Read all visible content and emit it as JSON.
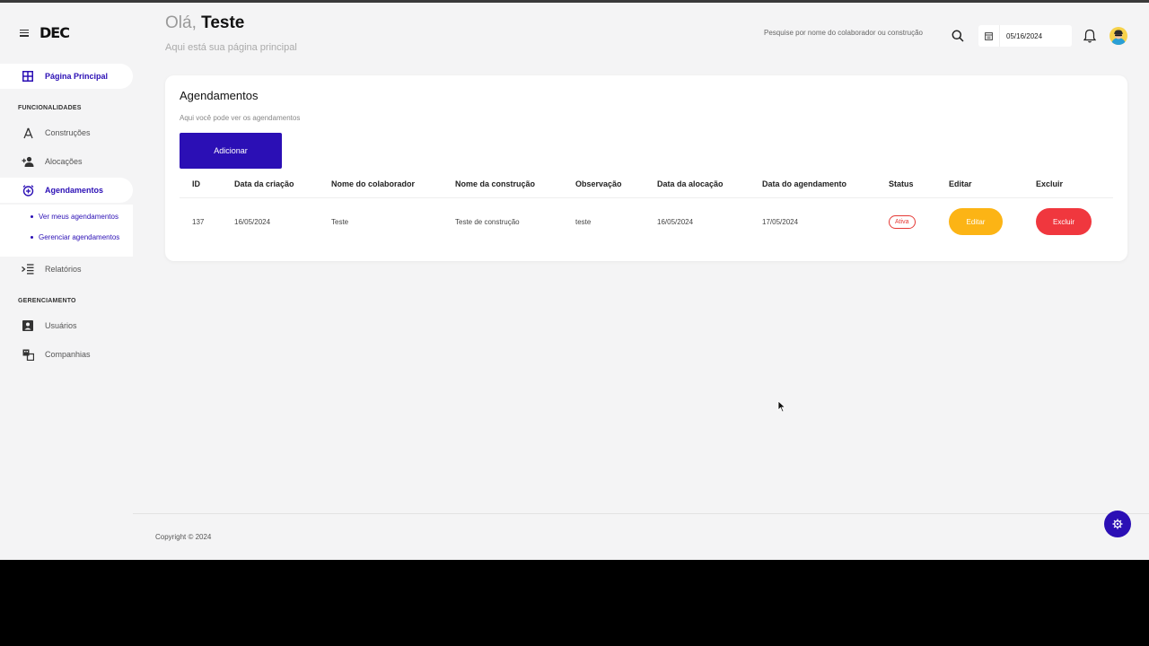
{
  "brand": {
    "logo": "DEC"
  },
  "header": {
    "greeting_prefix": "Olá,",
    "user_name": "Teste",
    "subtitle": "Aqui está sua página principal",
    "search_placeholder": "Pesquise por nome do colaborador ou construção",
    "date_value": "05/16/2024"
  },
  "sidebar": {
    "main_item": "Página Principal",
    "section_features": "FUNCIONALIDADES",
    "items": [
      {
        "label": "Construções",
        "icon": "compass-icon"
      },
      {
        "label": "Alocações",
        "icon": "person-add-icon"
      },
      {
        "label": "Agendamentos",
        "icon": "alarm-clock-icon"
      }
    ],
    "submenu": [
      "Ver meus agendamentos",
      "Gerenciar agendamentos"
    ],
    "reports": "Relatórios",
    "section_management": "GERENCIAMENTO",
    "management_items": [
      {
        "label": "Usuários",
        "icon": "user-card-icon"
      },
      {
        "label": "Companhias",
        "icon": "companies-icon"
      }
    ]
  },
  "card": {
    "title": "Agendamentos",
    "subtitle": "Aqui você pode ver os agendamentos",
    "add_button": "Adicionar",
    "columns": [
      "ID",
      "Data da criação",
      "Nome do colaborador",
      "Nome da construção",
      "Observação",
      "Data da alocação",
      "Data do agendamento",
      "Status",
      "Editar",
      "Excluir"
    ],
    "rows": [
      {
        "id": "137",
        "created": "16/05/2024",
        "collaborator": "Teste",
        "construction": "Teste de construção",
        "note": "teste",
        "allocation_date": "16/05/2024",
        "schedule_date": "17/05/2024",
        "status": "Ativa",
        "edit_label": "Editar",
        "delete_label": "Excluir"
      }
    ]
  },
  "footer": {
    "copyright": "Copyright © 2024"
  },
  "colors": {
    "primary": "#2b0fb5",
    "warning": "#fcb415",
    "danger": "#f0373e"
  }
}
